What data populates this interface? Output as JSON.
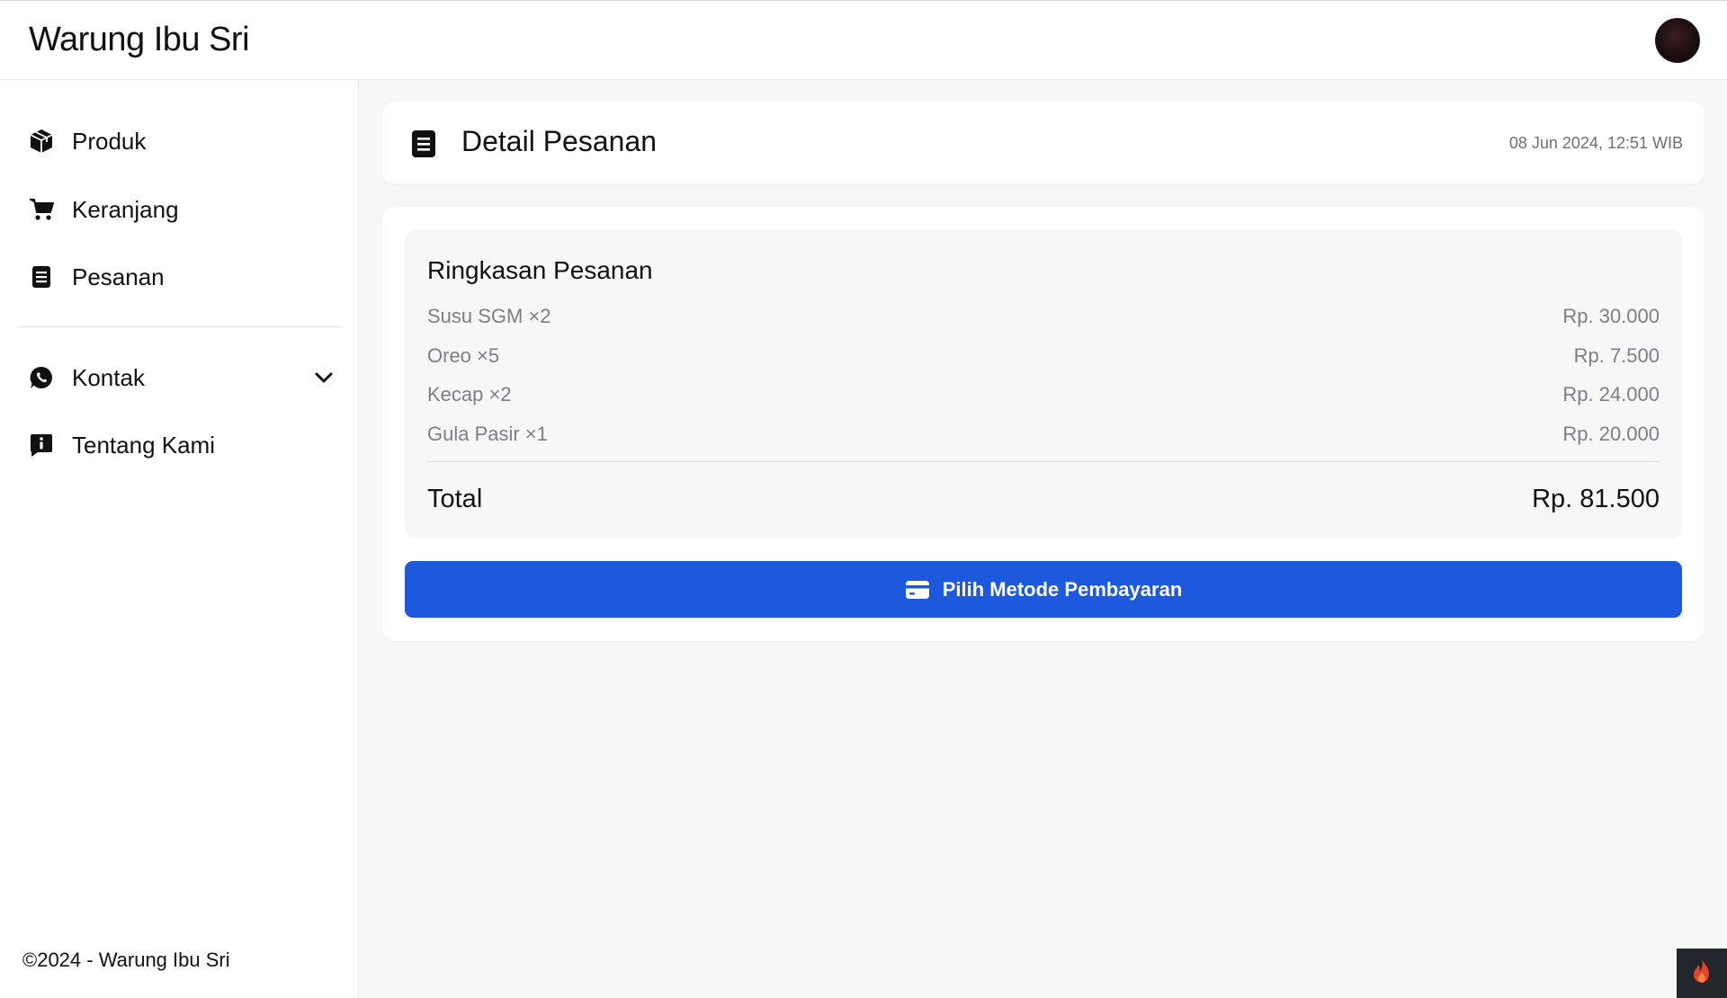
{
  "app": {
    "brand": "Warung Ibu Sri"
  },
  "sidebar": {
    "items": [
      {
        "label": "Produk",
        "icon": "box-icon"
      },
      {
        "label": "Keranjang",
        "icon": "cart-icon"
      },
      {
        "label": "Pesanan",
        "icon": "document-icon"
      },
      {
        "label": "Kontak",
        "icon": "whatsapp-icon",
        "expandable": true
      },
      {
        "label": "Tentang Kami",
        "icon": "info-chat-icon"
      }
    ],
    "footer": "©2024 - Warung Ibu Sri"
  },
  "header": {
    "title": "Detail Pesanan",
    "date": "08 Jun 2024, 12:51 WIB"
  },
  "summary": {
    "title": "Ringkasan Pesanan",
    "items": [
      {
        "name": "Susu SGM ×2",
        "price": "Rp. 30.000"
      },
      {
        "name": "Oreo ×5",
        "price": "Rp. 7.500"
      },
      {
        "name": "Kecap ×2",
        "price": "Rp. 24.000"
      },
      {
        "name": "Gula Pasir ×1",
        "price": "Rp. 20.000"
      }
    ],
    "total_label": "Total",
    "total_value": "Rp. 81.500"
  },
  "actions": {
    "pay_label": "Pilih Metode Pembayaran"
  },
  "colors": {
    "primary": "#1c59dc",
    "background": "#f6f7f7",
    "muted_text": "#7b8087"
  }
}
